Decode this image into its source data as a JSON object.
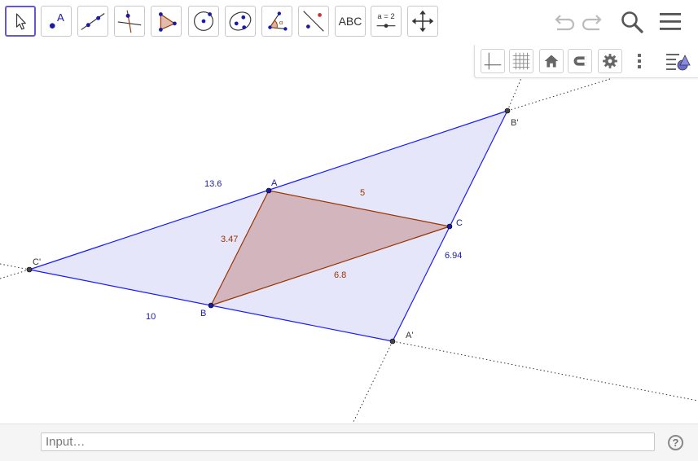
{
  "toolbar": {
    "tools": [
      {
        "name": "move-tool",
        "label": ""
      },
      {
        "name": "point-tool",
        "label": "A"
      },
      {
        "name": "line-tool",
        "label": ""
      },
      {
        "name": "perpendicular-line-tool",
        "label": ""
      },
      {
        "name": "polygon-tool",
        "label": ""
      },
      {
        "name": "circle-center-point-tool",
        "label": ""
      },
      {
        "name": "conic-five-points-tool",
        "label": ""
      },
      {
        "name": "angle-tool",
        "label": ""
      },
      {
        "name": "reflect-about-line-tool",
        "label": ""
      },
      {
        "name": "text-tool",
        "label": "ABC"
      },
      {
        "name": "slider-tool",
        "label": "a = 2"
      },
      {
        "name": "move-graphics-view-tool",
        "label": ""
      }
    ],
    "right_icons": [
      "undo-icon",
      "redo-icon",
      "search-icon",
      "menu-icon"
    ]
  },
  "style_bar": {
    "icons": [
      "axes-icon",
      "grid-icon",
      "home-icon",
      "magnet-icon",
      "gear-icon",
      "more-vertical-icon",
      "algebra-view-toggle-icon"
    ]
  },
  "graphics": {
    "points": {
      "A": "A",
      "B": "B",
      "C": "C",
      "A_prime": "A'",
      "B_prime": "B'",
      "C_prime": "C'"
    },
    "outer_segments": {
      "c_prime_b_prime": "13.6",
      "b_prime_a_prime": "6.94",
      "a_prime_c_prime": "10"
    },
    "inner_segments": {
      "ab": "3.47",
      "ac": "5",
      "bc": "6.8"
    },
    "colors": {
      "outer_fill": "#e6e6fa",
      "outer_stroke": "#1a1aff",
      "inner_fill": "#d3b6bd",
      "inner_stroke": "#993300",
      "point_fill": "#1a1aa8"
    }
  },
  "input_bar": {
    "placeholder": "Input…",
    "help_label": "?"
  }
}
